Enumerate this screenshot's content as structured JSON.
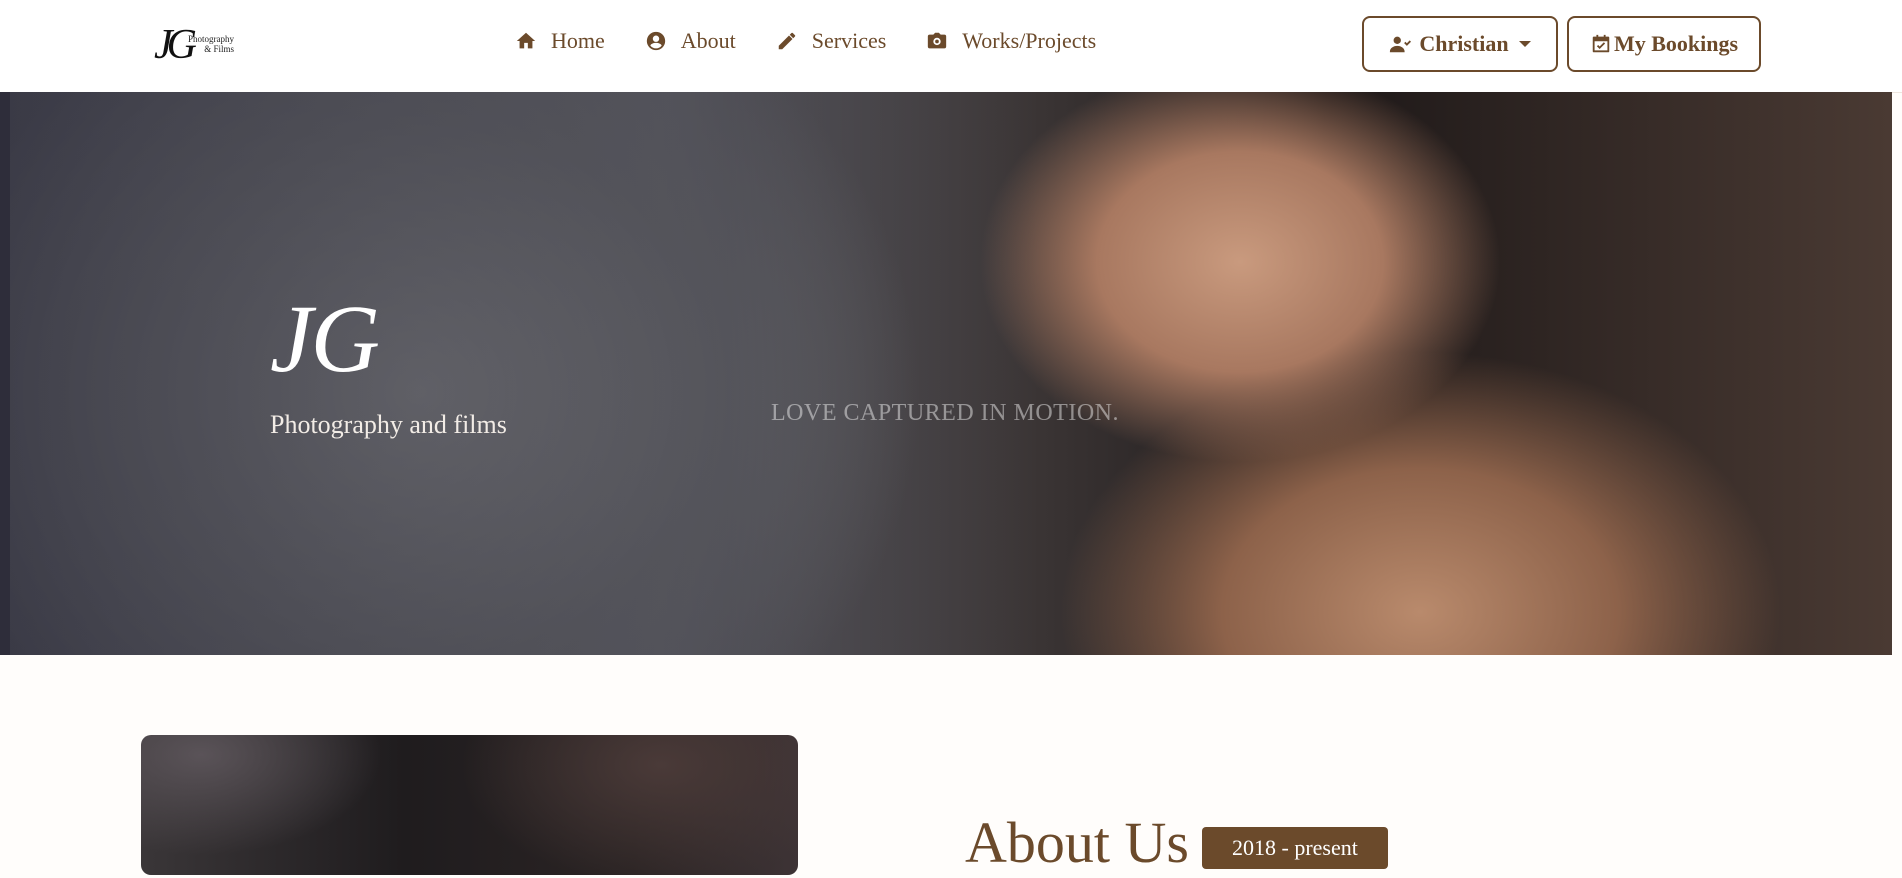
{
  "brand": {
    "monogram": "JG",
    "logo_line1": "Photography",
    "logo_line2": "& Films"
  },
  "nav": {
    "items": [
      {
        "label": "Home",
        "icon": "home-icon"
      },
      {
        "label": "About",
        "icon": "user-circle-icon"
      },
      {
        "label": "Services",
        "icon": "pencil-icon"
      },
      {
        "label": "Works/Projects",
        "icon": "camera-box-icon"
      }
    ],
    "user_label": "Christian",
    "bookings_label": "My Bookings"
  },
  "hero": {
    "title": "JG",
    "subtitle": "Photography and films",
    "tagline": "LOVE CAPTURED IN MOTION."
  },
  "about": {
    "title": "About Us",
    "badge": "2018 - present"
  },
  "colors": {
    "accent": "#6b4a2b",
    "background": "#fffdfb"
  }
}
